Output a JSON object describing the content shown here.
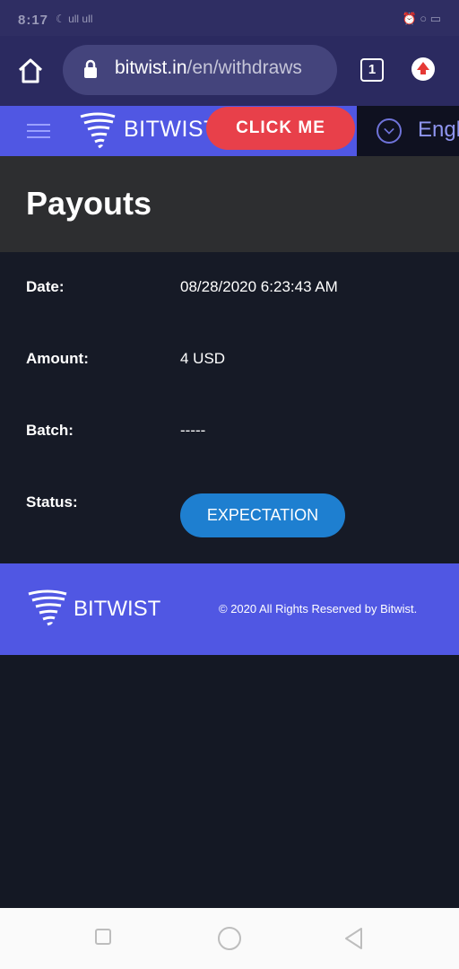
{
  "status_bar": {
    "time": "8:17",
    "signal_text": "☾ ull ull",
    "right_icons": "⏰ ○ ▭"
  },
  "browser": {
    "url_host": "bitwist.in",
    "url_path": "/en/withdraws",
    "tab_count": "1"
  },
  "site_nav": {
    "brand": "BITWIST",
    "cta_label": "CLICK ME",
    "language": "Engl"
  },
  "page": {
    "title": "Payouts",
    "fields": {
      "date_label": "Date:",
      "date_value": "08/28/2020 6:23:43 AM",
      "amount_label": "Amount:",
      "amount_value": "4 USD",
      "batch_label": "Batch:",
      "batch_value": "-----",
      "status_label": "Status:",
      "status_value": "EXPECTATION"
    }
  },
  "footer": {
    "brand": "BITWIST",
    "copyright": "© 2020 All Rights Reserved by Bitwist."
  },
  "colors": {
    "accent": "#5057e3",
    "cta": "#e8404a",
    "status_button": "#1e7fd0",
    "background": "#141824"
  }
}
